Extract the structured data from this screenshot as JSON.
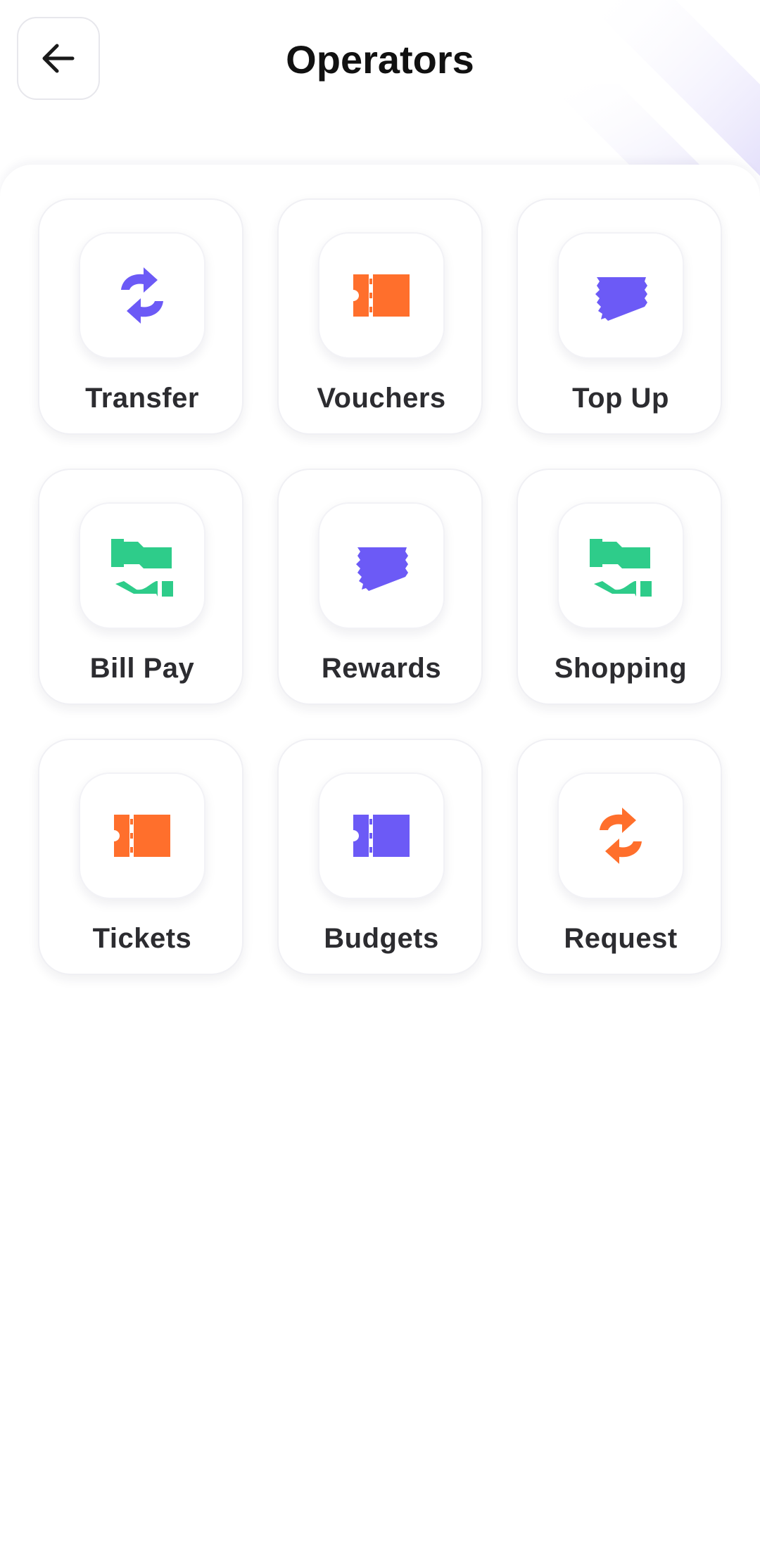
{
  "header": {
    "title": "Operators",
    "back_icon": "arrow-left-icon"
  },
  "colors": {
    "purple": "#6c5af6",
    "orange": "#ff6f2c",
    "green": "#2ecc8a"
  },
  "operators": [
    {
      "label": "Transfer",
      "icon": "transfer-icon",
      "color": "#6c5af6"
    },
    {
      "label": "Vouchers",
      "icon": "ticket-icon",
      "color": "#ff6f2c"
    },
    {
      "label": "Top Up",
      "icon": "torn-card-icon",
      "color": "#6c5af6"
    },
    {
      "label": "Bill Pay",
      "icon": "hand-pay-icon",
      "color": "#2ecc8a"
    },
    {
      "label": "Rewards",
      "icon": "torn-card-icon",
      "color": "#6c5af6"
    },
    {
      "label": "Shopping",
      "icon": "hand-pay-icon",
      "color": "#2ecc8a"
    },
    {
      "label": "Tickets",
      "icon": "ticket-icon",
      "color": "#ff6f2c"
    },
    {
      "label": "Budgets",
      "icon": "ticket-icon",
      "color": "#6c5af6"
    },
    {
      "label": "Request",
      "icon": "transfer-icon",
      "color": "#ff6f2c"
    }
  ]
}
